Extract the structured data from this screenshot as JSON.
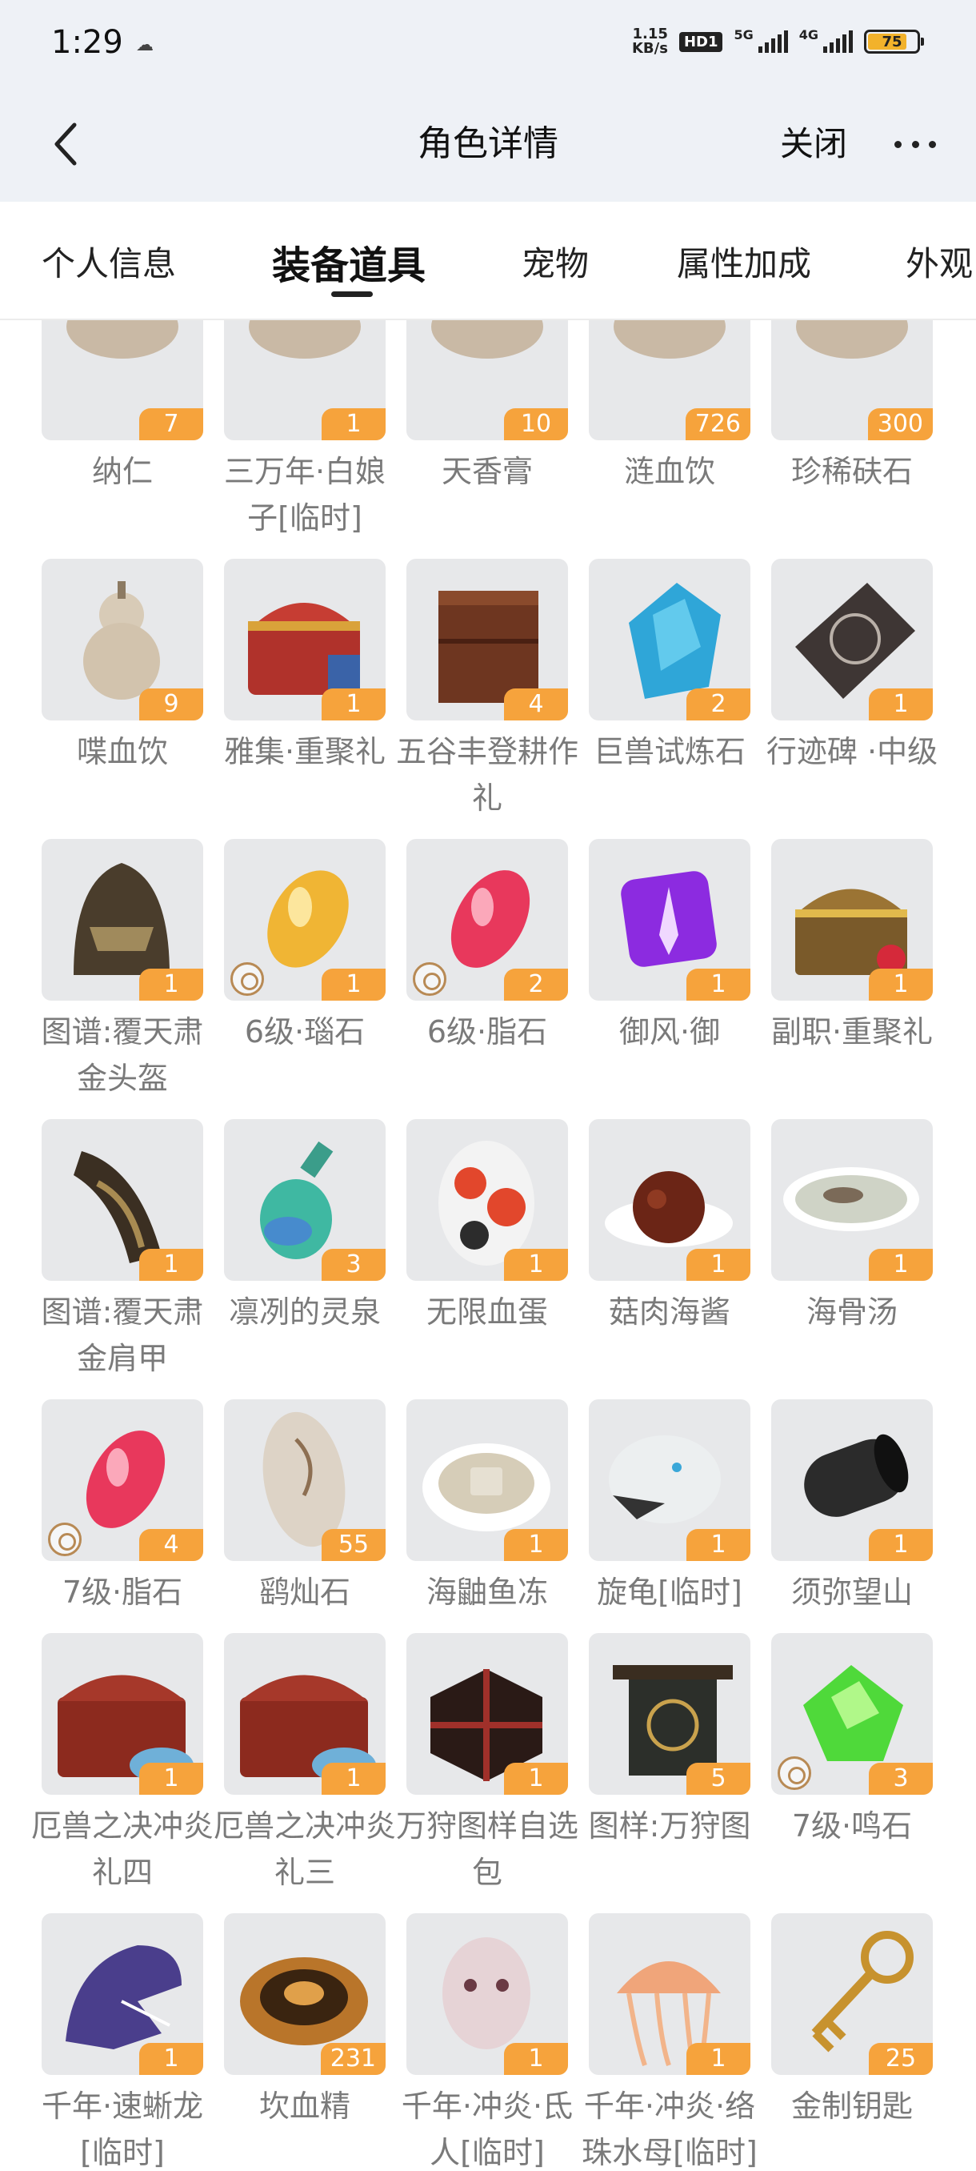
{
  "status": {
    "time": "1:29",
    "speed_top": "1.15",
    "speed_bottom": "KB/s",
    "hd": "HD1",
    "net1": "5G",
    "net2": "4G",
    "battery": "75"
  },
  "header": {
    "title": "角色详情",
    "close_label": "关闭"
  },
  "tabs": [
    {
      "label": "个人信息"
    },
    {
      "label": "装备道具"
    },
    {
      "label": "宠物"
    },
    {
      "label": "属性加成"
    },
    {
      "label": "外观"
    }
  ],
  "colors": {
    "badge": "#f6a33c",
    "tile_bg": "#e7e8ea",
    "header_bg": "#eef1f6"
  },
  "items": [
    {
      "name": "纳仁",
      "count": "7",
      "icon": "item-icon"
    },
    {
      "name": "三万年·白娘子[临时]",
      "count": "1",
      "icon": "item-icon"
    },
    {
      "name": "天香膏",
      "count": "10",
      "icon": "item-icon"
    },
    {
      "name": "涟血饮",
      "count": "726",
      "icon": "item-icon"
    },
    {
      "name": "珍稀砆石",
      "count": "300",
      "icon": "item-icon"
    },
    {
      "name": "喋血饮",
      "count": "9",
      "icon": "gourd-icon"
    },
    {
      "name": "雅集·重聚礼",
      "count": "1",
      "icon": "treasure-chest-icon"
    },
    {
      "name": "五谷丰登耕作礼",
      "count": "4",
      "icon": "wooden-box-icon"
    },
    {
      "name": "巨兽试炼石",
      "count": "2",
      "icon": "blue-crystal-icon"
    },
    {
      "name": "行迹碑 ·中级",
      "count": "1",
      "icon": "stone-tablet-icon"
    },
    {
      "name": "图谱:覆天肃金头盔",
      "count": "1",
      "icon": "helmet-icon"
    },
    {
      "name": "6级·瑙石",
      "count": "1",
      "icon": "amber-gem-icon",
      "bound": true
    },
    {
      "name": "6级·脂石",
      "count": "2",
      "icon": "pink-gem-icon",
      "bound": true
    },
    {
      "name": "御风·御",
      "count": "1",
      "icon": "purple-rune-icon"
    },
    {
      "name": "副职·重聚礼",
      "count": "1",
      "icon": "gold-chest-icon"
    },
    {
      "name": "图谱:覆天肃金肩甲",
      "count": "1",
      "icon": "shoulder-armor-icon"
    },
    {
      "name": "凛冽的灵泉",
      "count": "3",
      "icon": "potion-bottle-icon"
    },
    {
      "name": "无限血蛋",
      "count": "1",
      "icon": "blood-egg-icon"
    },
    {
      "name": "菇肉海酱",
      "count": "1",
      "icon": "meat-dish-icon"
    },
    {
      "name": "海骨汤",
      "count": "1",
      "icon": "soup-bowl-icon"
    },
    {
      "name": "7级·脂石",
      "count": "4",
      "icon": "pink-gem-icon",
      "bound": true
    },
    {
      "name": "鹞灿石",
      "count": "55",
      "icon": "carved-stone-icon"
    },
    {
      "name": "海鼬鱼冻",
      "count": "1",
      "icon": "fish-jelly-icon"
    },
    {
      "name": "旋龟[临时]",
      "count": "1",
      "icon": "white-beast-icon"
    },
    {
      "name": "须弥望山",
      "count": "1",
      "icon": "black-scroll-icon"
    },
    {
      "name": "厄兽之决冲炎礼四",
      "count": "1",
      "icon": "red-chest-icon"
    },
    {
      "name": "厄兽之决冲炎礼三",
      "count": "1",
      "icon": "red-chest-icon"
    },
    {
      "name": "万狩图样自选包",
      "count": "1",
      "icon": "lacquer-box-icon"
    },
    {
      "name": "图样:万狩图",
      "count": "5",
      "icon": "banner-icon"
    },
    {
      "name": "7级·鸣石",
      "count": "3",
      "icon": "green-gem-icon",
      "bound": true
    },
    {
      "name": "千年·速蜥龙[临时]",
      "count": "1",
      "icon": "raptor-icon"
    },
    {
      "name": "坎血精",
      "count": "231",
      "icon": "amber-disc-icon"
    },
    {
      "name": "千年·冲炎·氐人[临时]",
      "count": "1",
      "icon": "pale-creature-icon"
    },
    {
      "name": "千年·冲炎·络珠水母[临时]",
      "count": "1",
      "icon": "jellyfish-icon"
    },
    {
      "name": "金制钥匙",
      "count": "25",
      "icon": "gold-key-icon"
    }
  ]
}
